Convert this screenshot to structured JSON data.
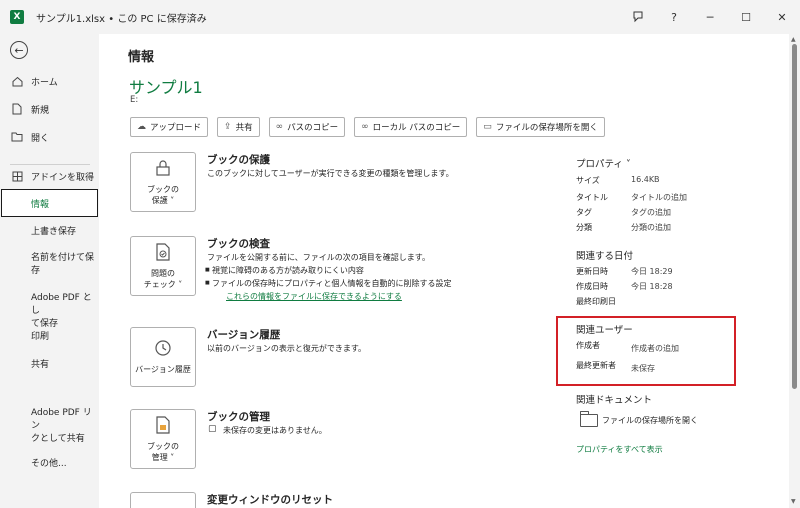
{
  "titlebar": {
    "app_logo": "X",
    "title": "サンプル1.xlsx • この PC に保存済み",
    "icons": [
      "feedback-icon",
      "help-icon",
      "minimize-icon",
      "maximize-icon",
      "close-icon"
    ],
    "help": "?",
    "minimize": "─",
    "maximize": "☐",
    "close": "✕"
  },
  "sidebar": {
    "back_icon": "←",
    "items": [
      {
        "label": "ホーム",
        "icon": "home-icon"
      },
      {
        "label": "新規",
        "icon": "new-file-icon"
      },
      {
        "label": "開く",
        "icon": "folder-open-icon"
      },
      {
        "label": "アドインを取得",
        "icon": "grid-icon"
      },
      {
        "label": "情報"
      },
      {
        "label": "上書き保存"
      },
      {
        "label": "名前を付けて保\n存"
      },
      {
        "label": "Adobe PDF とし\nて保存"
      },
      {
        "label": "印刷"
      },
      {
        "label": "共有"
      },
      {
        "label": "Adobe PDF リン\nクとして共有"
      },
      {
        "label": "その他..."
      }
    ]
  },
  "main": {
    "page_title": "情報",
    "doc_title": "サンプル1",
    "doc_path": "E:",
    "buttons": [
      {
        "label": "アップロード",
        "icon": "upload-icon"
      },
      {
        "label": "共有",
        "icon": "share-icon"
      },
      {
        "label": "パスのコピー",
        "icon": "link-icon"
      },
      {
        "label": "ローカル パスのコピー",
        "icon": "link-icon"
      },
      {
        "label": "ファイルの保存場所を開く",
        "icon": "folder-icon"
      }
    ],
    "sections": {
      "protect": {
        "btn_label_1": "ブックの",
        "btn_label_2": "保護 ˅",
        "title": "ブックの保護",
        "desc": "このブックに対してユーザーが実行できる変更の種類を管理します。"
      },
      "inspect": {
        "btn_label_1": "問題の",
        "btn_label_2": "チェック ˅",
        "title": "ブックの検査",
        "desc": "ファイルを公開する前に、ファイルの次の項目を確認します。",
        "bullets": [
          "視覚に障碍のある方が読み取りにくい内容",
          "ファイルの保存時にプロパティと個人情報を自動的に削除する設定"
        ],
        "link": "これらの情報をファイルに保存できるようにする"
      },
      "versions": {
        "btn_label": "バージョン履歴",
        "title": "バージョン履歴",
        "desc": "以前のバージョンの表示と復元ができます。"
      },
      "manage": {
        "btn_label_1": "ブックの",
        "btn_label_2": "管理 ˅",
        "title": "ブックの管理",
        "desc": "未保存の変更はありません。"
      },
      "reset": {
        "title": "変更ウィンドウのリセット"
      }
    }
  },
  "properties": {
    "header": "プロパティ ˅",
    "rows": [
      {
        "key": "サイズ",
        "value": "16.4KB"
      },
      {
        "key": "タイトル",
        "value": "タイトルの追加"
      },
      {
        "key": "タグ",
        "value": "タグの追加"
      },
      {
        "key": "分類",
        "value": "分類の追加"
      }
    ],
    "dates_header": "関連する日付",
    "dates": [
      {
        "key": "更新日時",
        "value": "今日 18:29"
      },
      {
        "key": "作成日時",
        "value": "今日 18:28"
      },
      {
        "key": "最終印刷日",
        "value": ""
      }
    ],
    "users_header": "関連ユーザー",
    "users": [
      {
        "key": "作成者",
        "value": "作成者の追加"
      },
      {
        "key": "最終更新者",
        "value": "未保存"
      }
    ],
    "docs_header": "関連ドキュメント",
    "open_location": "ファイルの保存場所を開く",
    "show_all": "プロパティをすべて表示"
  },
  "colors": {
    "accent": "#107c41",
    "highlight": "#d32026"
  }
}
